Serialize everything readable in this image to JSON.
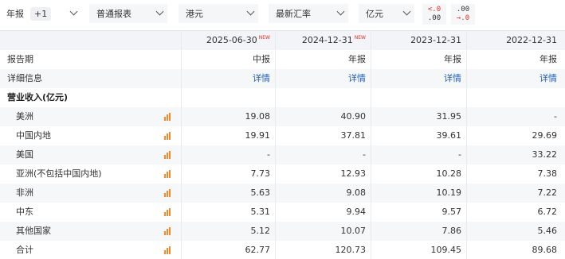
{
  "toolbar": {
    "period_label": "年报",
    "period_badge": "+1",
    "report_type": "普通报表",
    "currency": "港元",
    "rate": "最新汇率",
    "unit": "亿元",
    "dec_less": {
      "top": "<.0",
      "bottom": ".00"
    },
    "dec_more": {
      "top": ".00",
      "bottom": "→.0"
    }
  },
  "table": {
    "columns": [
      {
        "date": "2025-06-30",
        "tag": "NEW"
      },
      {
        "date": "2024-12-31",
        "tag": "NEW"
      },
      {
        "date": "2023-12-31",
        "tag": ""
      },
      {
        "date": "2022-12-31",
        "tag": ""
      }
    ],
    "report_period": {
      "label": "报告期",
      "values": [
        "中报",
        "年报",
        "年报",
        "年报"
      ]
    },
    "details": {
      "label": "详细信息",
      "values": [
        "详情",
        "详情",
        "详情",
        "详情"
      ]
    },
    "section_title": "营业收入(亿元)",
    "rows": [
      {
        "label": "美洲",
        "values": [
          "19.08",
          "40.90",
          "31.95",
          "-"
        ]
      },
      {
        "label": "中国内地",
        "values": [
          "19.91",
          "37.81",
          "39.61",
          "29.69"
        ]
      },
      {
        "label": "美国",
        "values": [
          "-",
          "-",
          "-",
          "33.22"
        ]
      },
      {
        "label": "亚洲(不包括中国内地)",
        "values": [
          "7.73",
          "12.93",
          "10.28",
          "7.38"
        ]
      },
      {
        "label": "非洲",
        "values": [
          "5.63",
          "9.08",
          "10.19",
          "7.22"
        ]
      },
      {
        "label": "中东",
        "values": [
          "5.31",
          "9.94",
          "9.57",
          "6.72"
        ]
      },
      {
        "label": "其他国家",
        "values": [
          "5.12",
          "10.07",
          "7.86",
          "5.46"
        ]
      },
      {
        "label": "合计",
        "values": [
          "62.77",
          "120.73",
          "109.45",
          "89.68"
        ]
      }
    ]
  },
  "colors": {
    "accent": "#e0301e",
    "link": "#1f5fbf",
    "chart_icon": "#f08a2b"
  },
  "icons": {
    "dropdown": "chevron-down-icon",
    "row_chart": "bar-chart-icon"
  }
}
